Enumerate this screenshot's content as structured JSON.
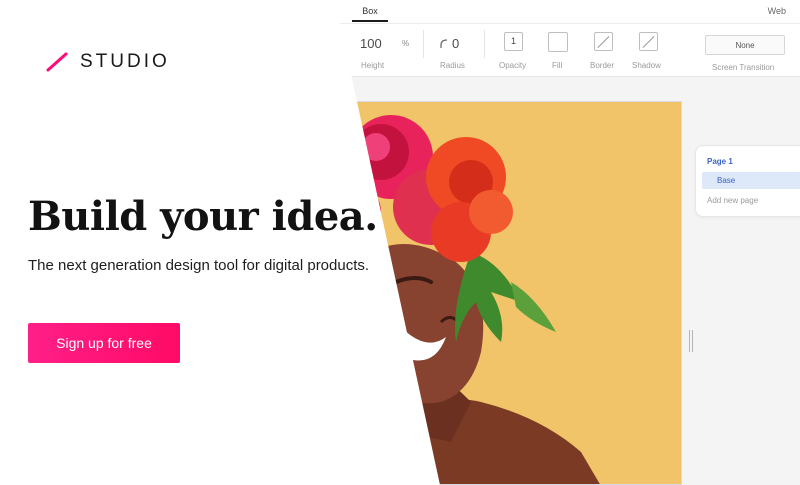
{
  "brand": {
    "name": "STUDIO",
    "accent": "#ff0a78"
  },
  "hero": {
    "headline": "Build your idea.",
    "subheadline": "The next generation design tool for digital products.",
    "cta_label": "Sign up for free",
    "cta_color": "#ff0f6e"
  },
  "editor": {
    "active_tab": "Box",
    "web_label": "Web",
    "toolbar": {
      "height_value": "100",
      "height_unit": "%",
      "height_label": "Height",
      "radius_value": "0",
      "radius_label": "Radius",
      "opacity_value": "1",
      "opacity_label": "Opacity",
      "fill_label": "Fill",
      "border_label": "Border",
      "shadow_label": "Shadow",
      "transition_value": "None",
      "transition_label": "Screen Transition"
    },
    "pages": {
      "page_name": "Page 1",
      "layers": [
        "Base"
      ],
      "add_label": "Add new page"
    },
    "artboard_color": "#f2c469"
  }
}
